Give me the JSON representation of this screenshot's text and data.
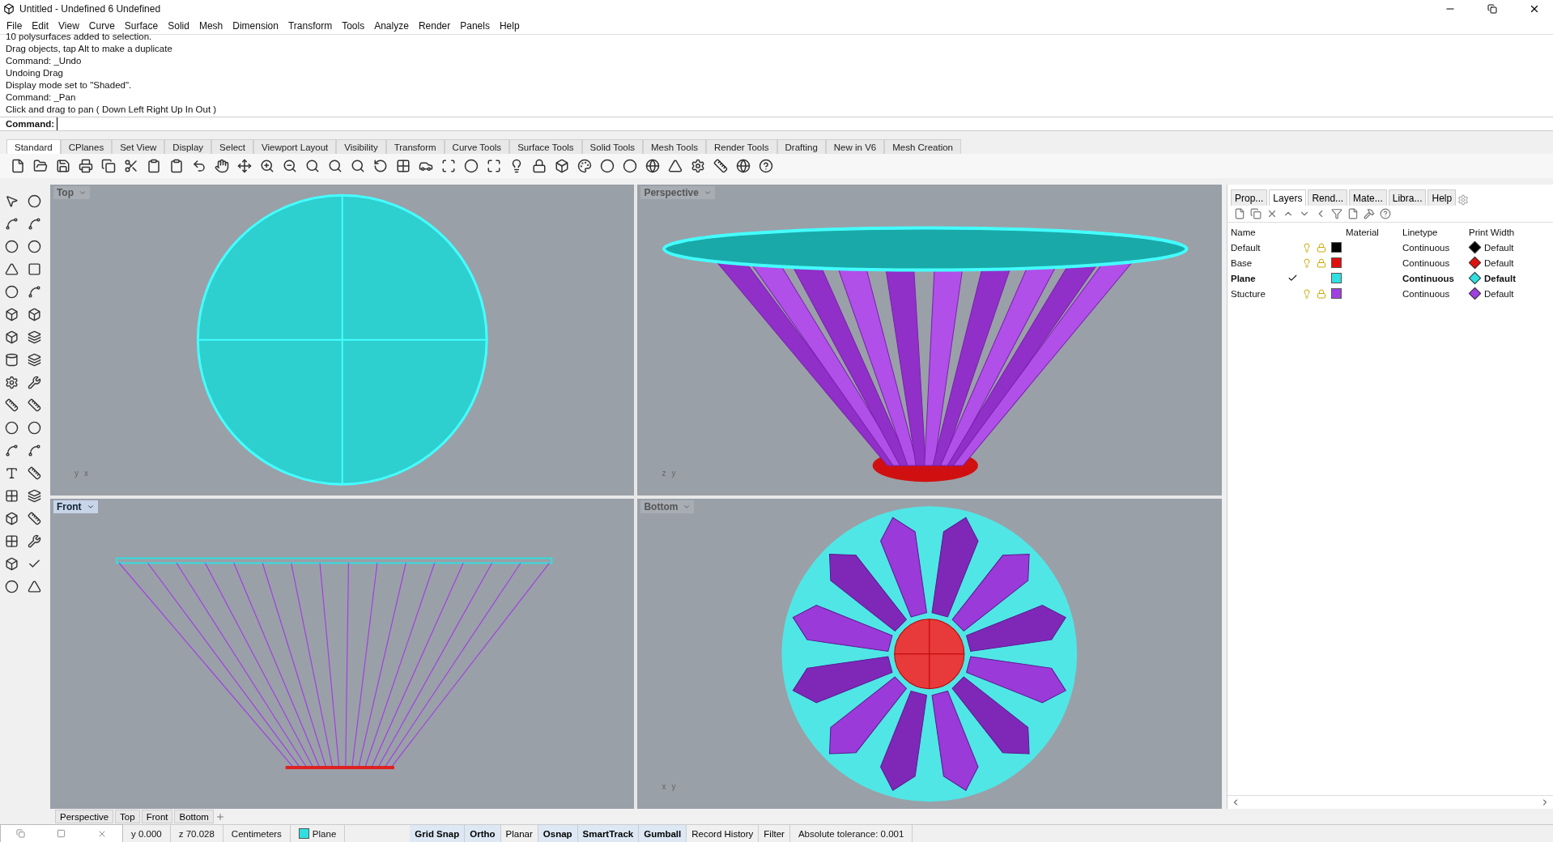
{
  "window": {
    "title": "Untitled - Undefined 6 Undefined"
  },
  "menu": [
    "File",
    "Edit",
    "View",
    "Curve",
    "Surface",
    "Solid",
    "Mesh",
    "Dimension",
    "Transform",
    "Tools",
    "Analyze",
    "Render",
    "Panels",
    "Help"
  ],
  "history": [
    "10 polysurfaces added to selection.",
    "Drag objects, tap Alt to make a duplicate",
    "Command: _Undo",
    "Undoing Drag",
    "Display mode set to \"Shaded\".",
    "Command: _Pan",
    "Click and drag to pan ( Down  Left  Right  Up  In  Out )"
  ],
  "command": {
    "label": "Command:"
  },
  "toolbar_tabs": [
    {
      "label": "Standard",
      "selected": true
    },
    {
      "label": "CPlanes",
      "selected": false
    },
    {
      "label": "Set View",
      "selected": false
    },
    {
      "label": "Display",
      "selected": false
    },
    {
      "label": "Select",
      "selected": false
    },
    {
      "label": "Viewport Layout",
      "selected": false
    },
    {
      "label": "Visibility",
      "selected": false
    },
    {
      "label": "Transform",
      "selected": false
    },
    {
      "label": "Curve Tools",
      "selected": false
    },
    {
      "label": "Surface Tools",
      "selected": false
    },
    {
      "label": "Solid Tools",
      "selected": false
    },
    {
      "label": "Mesh Tools",
      "selected": false
    },
    {
      "label": "Render Tools",
      "selected": false
    },
    {
      "label": "Drafting",
      "selected": false
    },
    {
      "label": "New in V6",
      "selected": false
    },
    {
      "label": "Mesh Creation",
      "selected": false
    }
  ],
  "viewports": [
    {
      "title": "Top",
      "kind": "top",
      "active": false,
      "axes": [
        "y",
        "x"
      ]
    },
    {
      "title": "Perspective",
      "kind": "perspective",
      "active": false,
      "axes": [
        "z",
        "y"
      ]
    },
    {
      "title": "Front",
      "kind": "front",
      "active": true
    },
    {
      "title": "Bottom",
      "kind": "bottom",
      "active": false,
      "axes": [
        "x",
        "y"
      ]
    }
  ],
  "viewport_tabs": [
    "Perspective",
    "Top",
    "Front",
    "Bottom"
  ],
  "panel": {
    "tabs": [
      {
        "label": "Prop...",
        "selected": false
      },
      {
        "label": "Layers",
        "selected": true
      },
      {
        "label": "Rend...",
        "selected": false
      },
      {
        "label": "Mate...",
        "selected": false
      },
      {
        "label": "Libra...",
        "selected": false
      },
      {
        "label": "Help",
        "selected": false
      }
    ],
    "columns": [
      "Name",
      "Material",
      "Linetype",
      "Print Width"
    ],
    "layers": [
      {
        "name": "Default",
        "current": false,
        "color": "#000000",
        "linetype": "Continuous",
        "print_width": "Default"
      },
      {
        "name": "Base",
        "current": false,
        "color": "#e01010",
        "linetype": "Continuous",
        "print_width": "Default"
      },
      {
        "name": "Plane",
        "current": true,
        "color": "#30e0e0",
        "linetype": "Continuous",
        "print_width": "Default"
      },
      {
        "name": "Stucture",
        "current": false,
        "color": "#a040e0",
        "linetype": "Continuous",
        "print_width": "Default"
      }
    ]
  },
  "status_bar": {
    "y": "y 0.000",
    "z": "z 70.028",
    "units": "Centimeters",
    "layer": "Plane",
    "toggles": [
      {
        "label": "Grid Snap",
        "on": true
      },
      {
        "label": "Ortho",
        "on": true
      },
      {
        "label": "Planar",
        "on": false
      },
      {
        "label": "Osnap",
        "on": true
      },
      {
        "label": "SmartTrack",
        "on": true
      },
      {
        "label": "Gumball",
        "on": true
      },
      {
        "label": "Record History",
        "on": false
      },
      {
        "label": "Filter",
        "on": false
      }
    ],
    "tolerance": "Absolute tolerance: 0.001"
  }
}
